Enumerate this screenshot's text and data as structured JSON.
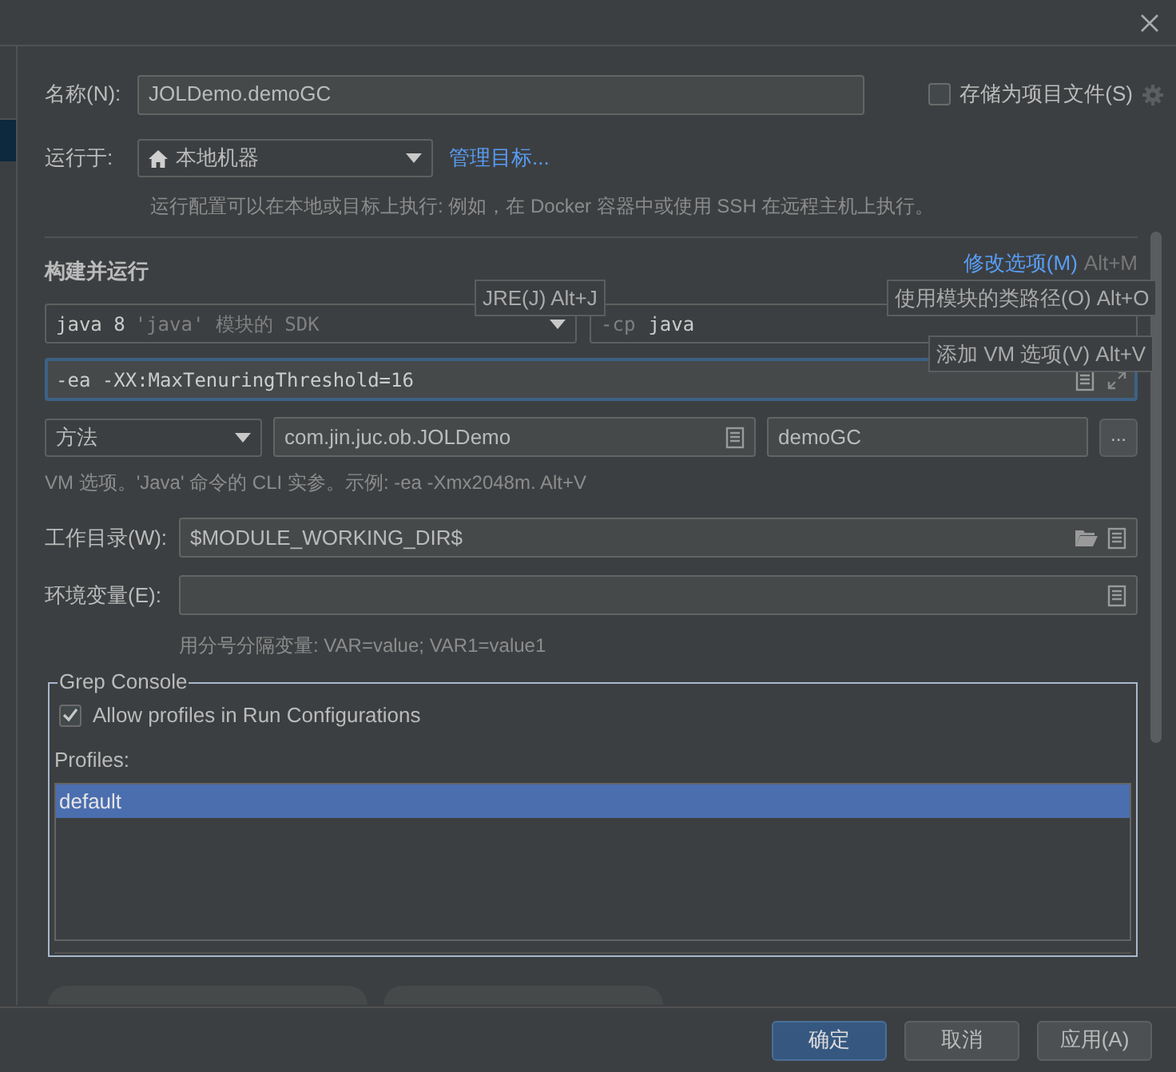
{
  "name_field": {
    "label": "名称(N):",
    "value": "JOLDemo.demoGC"
  },
  "store_as_project_file": {
    "label": "存储为项目文件(S)",
    "checked": false
  },
  "run_on": {
    "label": "运行于:",
    "value": "本地机器",
    "link": "管理目标..."
  },
  "run_on_hint": "运行配置可以在本地或目标上执行: 例如，在 Docker 容器中或使用 SSH 在远程主机上执行。",
  "build_and_run": {
    "title": "构建并运行",
    "modify_options": "修改选项(M)",
    "modify_shortcut": "Alt+M",
    "jre": {
      "value": "java 8",
      "hint": "'java' 模块的 SDK"
    },
    "classpath": {
      "prefix": "-cp",
      "value": "java"
    },
    "vm_options": "-ea -XX:MaxTenuringThreshold=16",
    "main_kind": "方法",
    "main_class": "com.jin.juc.ob.JOLDemo",
    "method": "demoGC",
    "more_button": "...",
    "vm_hint": "VM 选项。'Java' 命令的 CLI 实参。示例: -ea -Xmx2048m. Alt+V"
  },
  "tooltips": [
    {
      "text": "JRE(J) Alt+J"
    },
    {
      "text": "使用模块的类路径(O) Alt+O"
    },
    {
      "text": "添加 VM 选项(V) Alt+V"
    }
  ],
  "working_dir": {
    "label": "工作目录(W):",
    "value": "$MODULE_WORKING_DIR$"
  },
  "env_vars": {
    "label": "环境变量(E):",
    "hint": "用分号分隔变量: VAR=value; VAR1=value1"
  },
  "grep_console": {
    "title": "Grep Console",
    "allow_profiles": {
      "label": "Allow profiles in Run Configurations",
      "checked": true
    },
    "profiles_label": "Profiles:",
    "profiles": [
      {
        "name": "default",
        "selected": true
      }
    ]
  },
  "buttons": [
    {
      "label": "确定",
      "kind": "primary"
    },
    {
      "label": "取消",
      "kind": "normal"
    },
    {
      "label": "应用(A)",
      "kind": "normal"
    }
  ]
}
